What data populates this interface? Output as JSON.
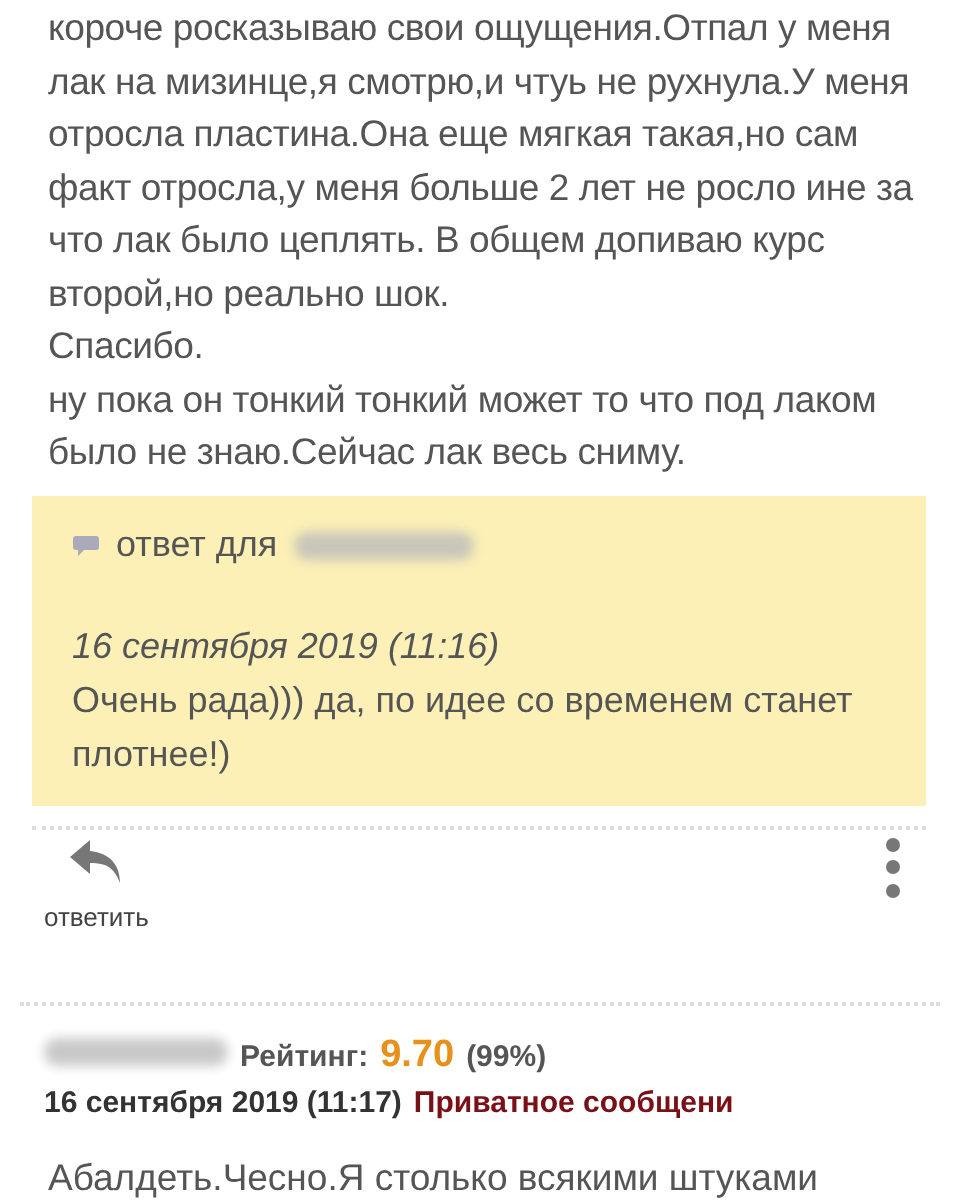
{
  "post_body": {
    "paragraphs": [
      "короче росказываю свои ощущения.Отпал у меня лак на мизинце,я смотрю,и чтуь не рухнула.У меня отросла пластина.Она еще мягкая такая,но сам факт отросла,у меня больше 2 лет не росло ине за что лак было цеплять. В общем допиваю курс второй,но реально шок.",
      "Спасибо.",
      "ну пока он тонкий тонкий может то что под лаком было не знаю.Сейчас лак весь сниму."
    ]
  },
  "reply_box": {
    "reply_to_label": "ответ для",
    "date": "16 сентября 2019 (11:16)",
    "text": "Очень рада))) да, по идее со временем станет плотнее!)"
  },
  "actions": {
    "reply_label": "ответить"
  },
  "next_post": {
    "rating_label": "Рейтинг:",
    "rating_value": "9.70",
    "rating_percent": "(99%)",
    "date": "16 сентября 2019 (11:17)",
    "private_message_link": "Приватное сообщени",
    "text": "Абалдеть.Чесно.Я столько всякими штуками"
  }
}
